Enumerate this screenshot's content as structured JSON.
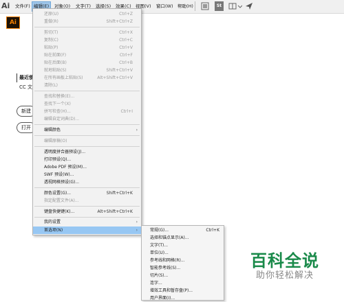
{
  "app": {
    "logo": "Ai",
    "tile": "Ai"
  },
  "menubar": {
    "items": [
      "文件(F)",
      "编辑(E)",
      "对象(O)",
      "文字(T)",
      "选择(S)",
      "效果(C)",
      "视图(V)",
      "窗口(W)",
      "帮助(H)"
    ],
    "toolbar_st": "St"
  },
  "left": {
    "recent_title": "最近使",
    "cc_text": "CC 文",
    "new_button": "新建",
    "open_button": "打开"
  },
  "edit_menu": {
    "rows": [
      {
        "label": "还原(U)",
        "shortcut": "Ctrl+Z",
        "disabled": true
      },
      {
        "label": "重做(R)",
        "shortcut": "Shift+Ctrl+Z",
        "disabled": true
      },
      {
        "label": "剪切(T)",
        "shortcut": "Ctrl+X",
        "disabled": true
      },
      {
        "label": "复制(C)",
        "shortcut": "Ctrl+C",
        "disabled": true
      },
      {
        "label": "粘贴(P)",
        "shortcut": "Ctrl+V",
        "disabled": true
      },
      {
        "label": "贴在前面(F)",
        "shortcut": "Ctrl+F",
        "disabled": true
      },
      {
        "label": "贴在后面(B)",
        "shortcut": "Ctrl+B",
        "disabled": true
      },
      {
        "label": "就地粘贴(S)",
        "shortcut": "Shift+Ctrl+V",
        "disabled": true
      },
      {
        "label": "在所有画板上粘贴(S)",
        "shortcut": "Alt+Shift+Ctrl+V",
        "disabled": true
      },
      {
        "label": "清除(L)",
        "shortcut": "",
        "disabled": true
      },
      {
        "label": "查找和替换(E)...",
        "shortcut": "",
        "disabled": true
      },
      {
        "label": "查找下一个(X)",
        "shortcut": "",
        "disabled": true
      },
      {
        "label": "拼写检查(H)...",
        "shortcut": "Ctrl+I",
        "disabled": true
      },
      {
        "label": "编辑自定词典(D)...",
        "shortcut": "",
        "disabled": true
      },
      {
        "label": "编辑颜色",
        "shortcut": "",
        "disabled": false,
        "submenu": true
      },
      {
        "label": "编辑原稿(O)",
        "shortcut": "",
        "disabled": true
      },
      {
        "label": "透明度拼合器预设(J)...",
        "shortcut": "",
        "disabled": false
      },
      {
        "label": "打印预设(Q)...",
        "shortcut": "",
        "disabled": false
      },
      {
        "label": "Adobe PDF 预设(M)...",
        "shortcut": "",
        "disabled": false
      },
      {
        "label": "SWF 预设(W)...",
        "shortcut": "",
        "disabled": false
      },
      {
        "label": "透视网格预设(G)...",
        "shortcut": "",
        "disabled": false
      },
      {
        "label": "颜色设置(G)...",
        "shortcut": "Shift+Ctrl+K",
        "disabled": false
      },
      {
        "label": "指定配置文件(A)...",
        "shortcut": "",
        "disabled": true
      },
      {
        "label": "键盘快捷键(K)...",
        "shortcut": "Alt+Shift+Ctrl+K",
        "disabled": false
      },
      {
        "label": "我的设置",
        "shortcut": "",
        "disabled": false,
        "submenu": true
      },
      {
        "label": "首选项(N)",
        "shortcut": "",
        "disabled": false,
        "submenu": true,
        "highlighted": true
      }
    ]
  },
  "prefs_submenu": {
    "rows": [
      {
        "label": "常规(G)...",
        "shortcut": "Ctrl+K"
      },
      {
        "label": "选择和锚点显示(A)...",
        "shortcut": ""
      },
      {
        "label": "文字(T)...",
        "shortcut": ""
      },
      {
        "label": "单位(U)...",
        "shortcut": ""
      },
      {
        "label": "参考线和网格(R)...",
        "shortcut": ""
      },
      {
        "label": "智能参考线(S)...",
        "shortcut": ""
      },
      {
        "label": "切片(S)...",
        "shortcut": ""
      },
      {
        "label": "连字...",
        "shortcut": ""
      },
      {
        "label": "增效工具和暂存盘(P)...",
        "shortcut": ""
      },
      {
        "label": "用户界面(I)...",
        "shortcut": ""
      }
    ]
  },
  "watermark": {
    "title": "百科全说",
    "subtitle": "助你轻松解决"
  }
}
